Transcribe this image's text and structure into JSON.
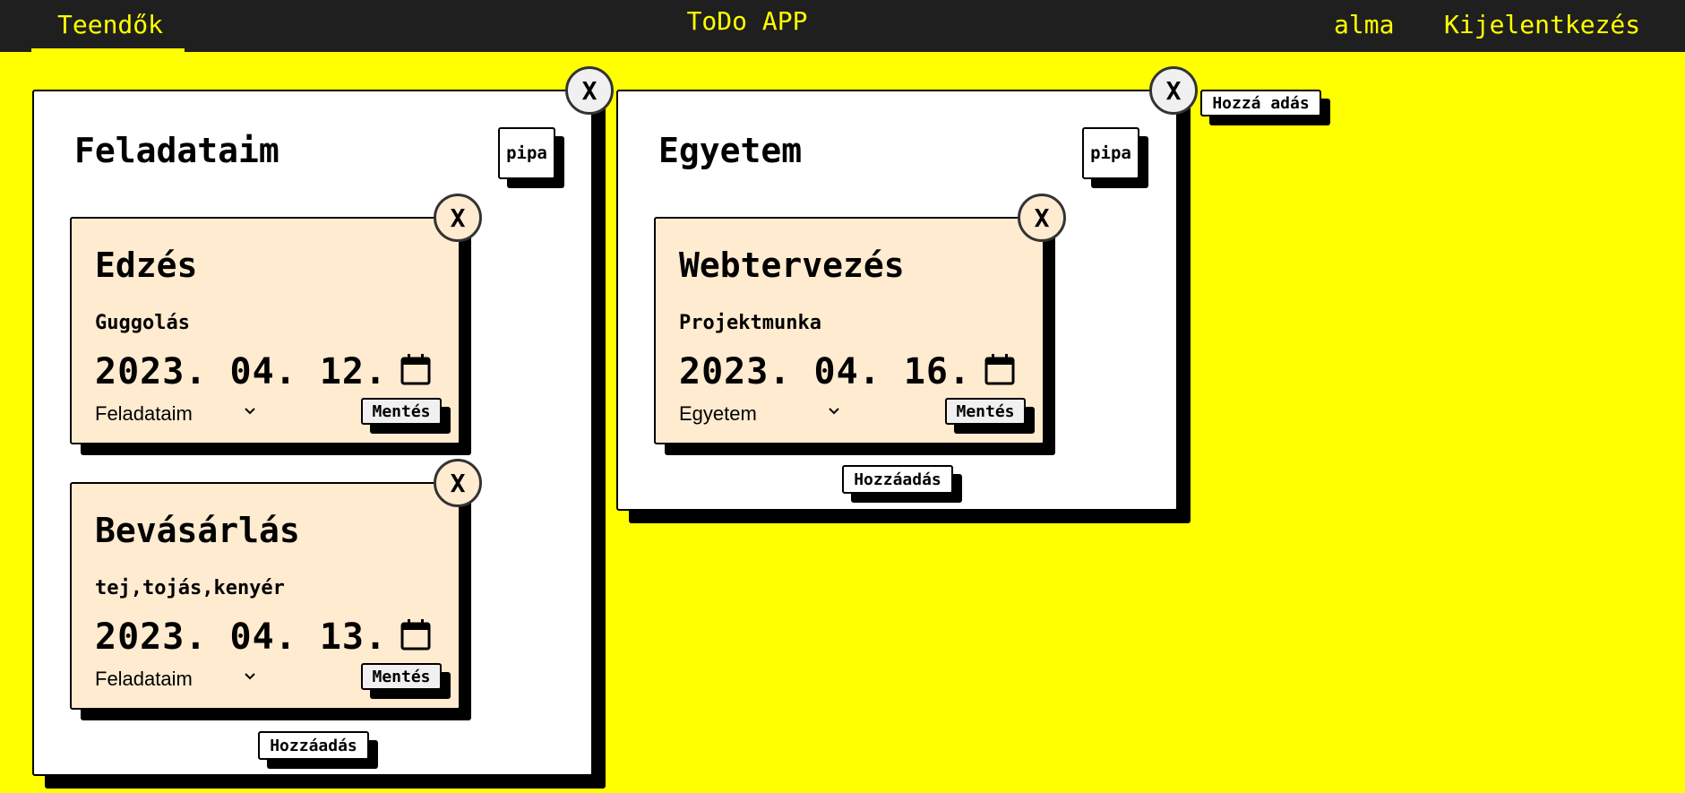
{
  "nav": {
    "tab_todos": "Teendők",
    "title": "ToDo APP",
    "user": "alma",
    "logout": "Kijelentkezés"
  },
  "add_list_label": "Hozzá adás",
  "close_label": "X",
  "lists": [
    {
      "title": "Feladataim",
      "pipa_label": "pipa",
      "add_label": "Hozzáadás",
      "cards": [
        {
          "title": "Edzés",
          "description": "Guggolás",
          "date": "2023. 04. 12.",
          "list_select": "Feladataim",
          "save_label": "Mentés"
        },
        {
          "title": "Bevásárlás",
          "description": "tej,tojás,kenyér",
          "date": "2023. 04. 13.",
          "list_select": "Feladataim",
          "save_label": "Mentés"
        }
      ]
    },
    {
      "title": "Egyetem",
      "pipa_label": "pipa",
      "add_label": "Hozzáadás",
      "cards": [
        {
          "title": "Webtervezés",
          "description": "Projektmunka",
          "date": "2023. 04. 16.",
          "list_select": "Egyetem",
          "save_label": "Mentés"
        }
      ]
    }
  ],
  "colors": {
    "background": "#ffff00",
    "navbar": "#1f1f1f",
    "accent_text": "#ffff00",
    "card": "#ffebd0",
    "list": "#ffffff"
  }
}
